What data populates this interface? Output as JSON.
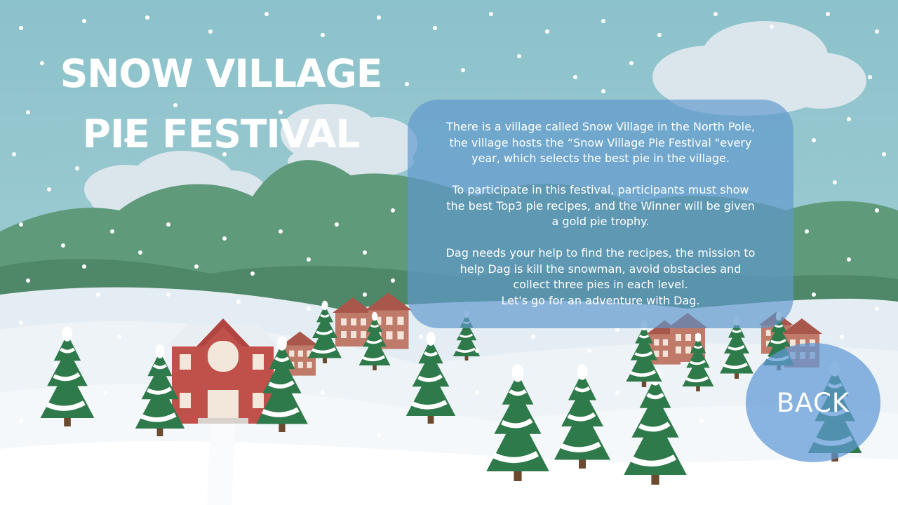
{
  "title": {
    "line1": "SNOW VILLAGE",
    "line2": "PIE FESTIVAL"
  },
  "story": {
    "paragraph1_line1": "There is a village called Snow Village in the North Pole,",
    "paragraph1_line2": "the village hosts the    “Snow Village Pie Festival \"every",
    "paragraph1_line3": "year, which selects the best pie in the village.",
    "paragraph2_line1": "To participate in this festival, participants must show",
    "paragraph2_line2": "the best Top3 pie recipes, and the Winner will be given",
    "paragraph2_line3": "a gold pie trophy.",
    "paragraph3_line1": "Dag needs your help to find the recipes, the mission to",
    "paragraph3_line2": "help Dag is kill the snowman, avoid obstacles and",
    "paragraph3_line3": "collect three pies in each level.",
    "paragraph3_line4": "Let's go for an adventure with Dag."
  },
  "back_button": {
    "label": "BACK"
  },
  "colors": {
    "sky": "#8fc4cc",
    "hills": "#5f9a7a",
    "snow": "#eef3f7",
    "house_red": "#c0504a",
    "tree_green": "#2f7a4a",
    "panel_blue": "#6098cd",
    "button_blue": "#6098d7",
    "text_white": "#ffffff"
  }
}
